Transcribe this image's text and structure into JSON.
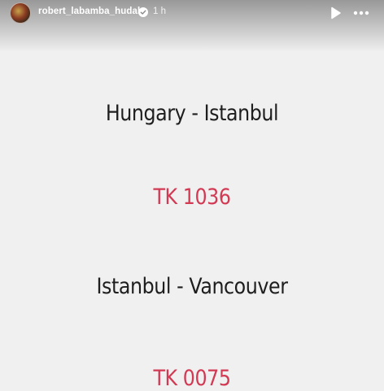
{
  "header": {
    "username": "robert_labamba_hudak",
    "timestamp": "1 h",
    "icons": {
      "verified": "verified-badge-icon",
      "play": "play-icon",
      "more": "more-icon"
    }
  },
  "story": {
    "lines": [
      {
        "text": "Hungary - Istanbul",
        "kind": "route"
      },
      {
        "text": "TK 1036",
        "kind": "flight"
      },
      {
        "text": "Istanbul - Vancouver",
        "kind": "route"
      },
      {
        "text": "TK 0075",
        "kind": "flight"
      }
    ]
  },
  "colors": {
    "background": "#f0f0f0",
    "route_text": "#1e1e1e",
    "flight_text": "#d23a54"
  }
}
